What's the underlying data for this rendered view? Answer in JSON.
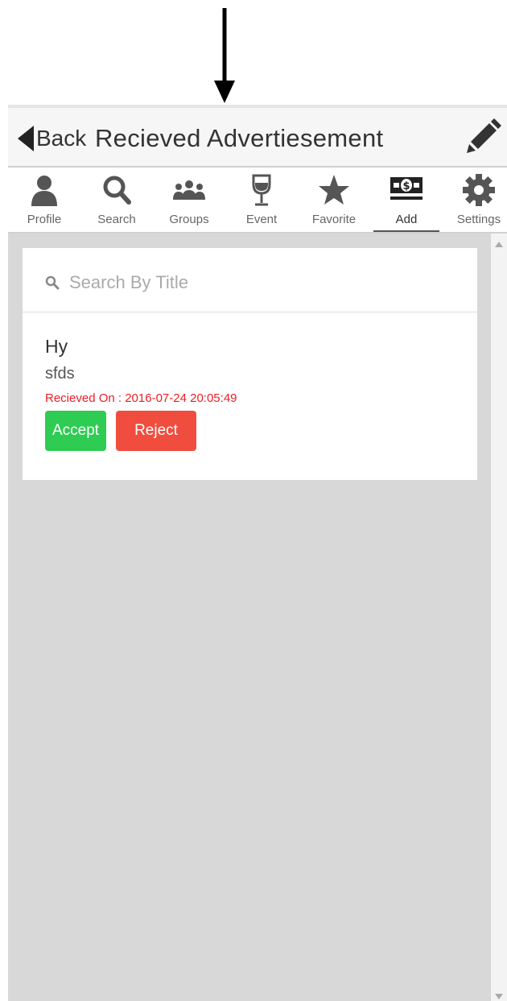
{
  "header": {
    "back_label": "Back",
    "title": "Recieved Advertiesement"
  },
  "nav": {
    "items": [
      {
        "label": "Profile",
        "icon": "user-icon"
      },
      {
        "label": "Search",
        "icon": "search-icon"
      },
      {
        "label": "Groups",
        "icon": "groups-icon"
      },
      {
        "label": "Event",
        "icon": "wine-glass-icon"
      },
      {
        "label": "Favorite",
        "icon": "star-icon"
      },
      {
        "label": "Add",
        "icon": "money-icon",
        "active": true
      },
      {
        "label": "Settings",
        "icon": "gear-icon"
      }
    ]
  },
  "search": {
    "placeholder": "Search By Title",
    "value": ""
  },
  "advertisements": [
    {
      "title": "Hy",
      "description": "sfds",
      "received_on": "Recieved On : 2016-07-24 20:05:49",
      "accept_label": "Accept",
      "reject_label": "Reject"
    }
  ],
  "colors": {
    "accept": "#2ecc52",
    "reject": "#f04d3e",
    "date_text": "#ee1c25",
    "content_bg": "#d8d8d8"
  }
}
